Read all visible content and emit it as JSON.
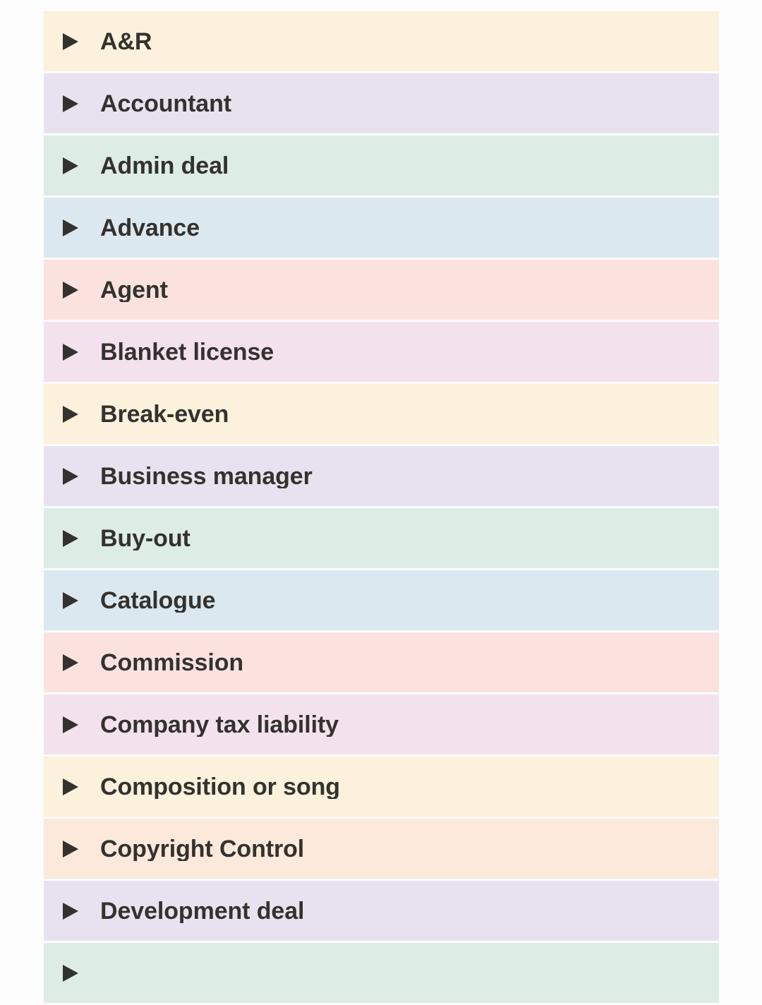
{
  "page": {
    "background_color": "#fcfcfc",
    "text_color": "#34322e",
    "icon_name": "disclosure-triangle-collapsed-icon",
    "icon_glyph": "▶",
    "icon_color": "#34322e"
  },
  "palette": {
    "cream": "#fbf1dc",
    "lavender": "#e8e2f0",
    "mint": "#ddede6",
    "blue": "#dce8f0",
    "salmon": "#fbe2de",
    "magenta": "#f3e2ee",
    "peach": "#fbe9dc"
  },
  "list": {
    "name": "glossary-accordion",
    "rows": [
      {
        "label": "A&R",
        "color": "#fbf1dc",
        "expanded": false
      },
      {
        "label": "Accountant",
        "color": "#e8e2f0",
        "expanded": false
      },
      {
        "label": "Admin deal",
        "color": "#ddede6",
        "expanded": false
      },
      {
        "label": "Advance",
        "color": "#dce8f0",
        "expanded": false
      },
      {
        "label": "Agent",
        "color": "#fbe2de",
        "expanded": false
      },
      {
        "label": "Blanket license",
        "color": "#f3e2ee",
        "expanded": false
      },
      {
        "label": "Break-even",
        "color": "#fbf1dc",
        "expanded": false
      },
      {
        "label": "Business manager",
        "color": "#e8e2f0",
        "expanded": false
      },
      {
        "label": "Buy-out",
        "color": "#ddede6",
        "expanded": false
      },
      {
        "label": "Catalogue",
        "color": "#dce8f0",
        "expanded": false
      },
      {
        "label": "Commission",
        "color": "#fbe2de",
        "expanded": false
      },
      {
        "label": "Company tax liability",
        "color": "#f3e2ee",
        "expanded": false
      },
      {
        "label": "Composition or song",
        "color": "#fbf1dc",
        "expanded": false
      },
      {
        "label": "Copyright Control",
        "color": "#fbe9dc",
        "expanded": false
      },
      {
        "label": "Development deal",
        "color": "#e8e2f0",
        "expanded": false
      },
      {
        "label": "",
        "color": "#ddede6",
        "expanded": false
      }
    ]
  }
}
